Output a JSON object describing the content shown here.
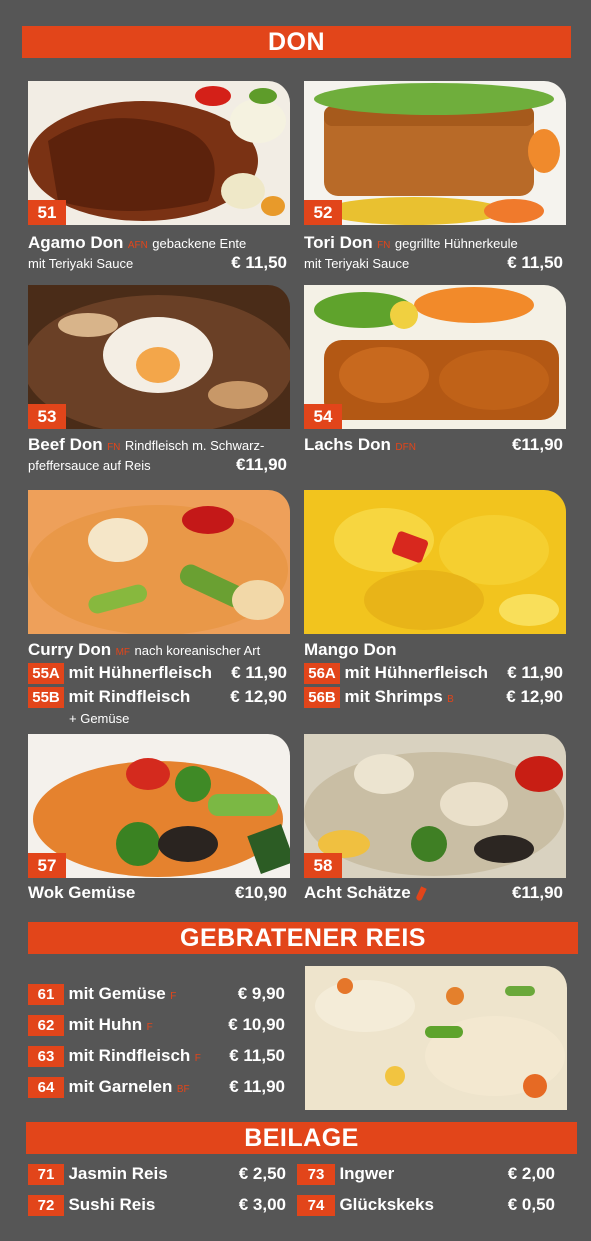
{
  "colors": {
    "background": "#565656",
    "accent": "#e2451a",
    "text": "#ffffff"
  },
  "sections": {
    "don": "DON",
    "reis": "GEBRATENER REIS",
    "beilage": "BEILAGE"
  },
  "don_items": [
    {
      "num": "51",
      "name": "Agamo Don",
      "alg": "AFN",
      "desc1": "gebackene Ente",
      "desc2": "mit Teriyaki Sauce",
      "price": "€ 11,50"
    },
    {
      "num": "52",
      "name": "Tori Don",
      "alg": "FN",
      "desc1": "gegrillte Hühnerkeule",
      "desc2": "mit Teriyaki Sauce",
      "price": "€ 11,50"
    },
    {
      "num": "53",
      "name": "Beef Don",
      "alg": "FN",
      "desc1": "Rindfleisch m. Schwarz-",
      "desc2": "pfeffersauce auf Reis",
      "price": "€11,90"
    },
    {
      "num": "54",
      "name": "Lachs Don",
      "alg": "DFN",
      "desc1": "",
      "desc2": "",
      "price": "€11,90"
    },
    {
      "name": "Curry Don",
      "alg": "MF",
      "desc1": "nach koreanischer Art",
      "desc3": "+ Gemüse",
      "variants": [
        {
          "code": "55A",
          "label": "mit Hühnerfleisch",
          "price": "€ 11,90"
        },
        {
          "code": "55B",
          "label": "mit Rindfleisch",
          "price": "€ 12,90"
        }
      ]
    },
    {
      "name": "Mango Don",
      "variants": [
        {
          "code": "56A",
          "label": "mit Hühnerfleisch",
          "price": "€ 11,90"
        },
        {
          "code": "56B",
          "label": "mit Shrimps",
          "alg": "B",
          "price": "€ 12,90"
        }
      ]
    },
    {
      "num": "57",
      "name": "Wok Gemüse",
      "price": "€10,90"
    },
    {
      "num": "58",
      "name": "Acht Schätze",
      "price": "€11,90",
      "icon": "chili-pepper-icon"
    }
  ],
  "reis_items": [
    {
      "num": "61",
      "label": "mit Gemüse",
      "alg": "F",
      "price": "€ 9,90"
    },
    {
      "num": "62",
      "label": "mit Huhn",
      "alg": "F",
      "price": "€ 10,90"
    },
    {
      "num": "63",
      "label": "mit Rindfleisch",
      "alg": "F",
      "price": "€ 11,50"
    },
    {
      "num": "64",
      "label": "mit Garnelen",
      "alg": "BF",
      "price": "€ 11,90"
    }
  ],
  "beilage_items": [
    {
      "num": "71",
      "label": "Jasmin Reis",
      "price": "€ 2,50"
    },
    {
      "num": "72",
      "label": "Sushi Reis",
      "price": "€ 3,00"
    },
    {
      "num": "73",
      "label": "Ingwer",
      "price": "€ 2,00"
    },
    {
      "num": "74",
      "label": "Glückskeks",
      "price": "€ 0,50"
    }
  ]
}
